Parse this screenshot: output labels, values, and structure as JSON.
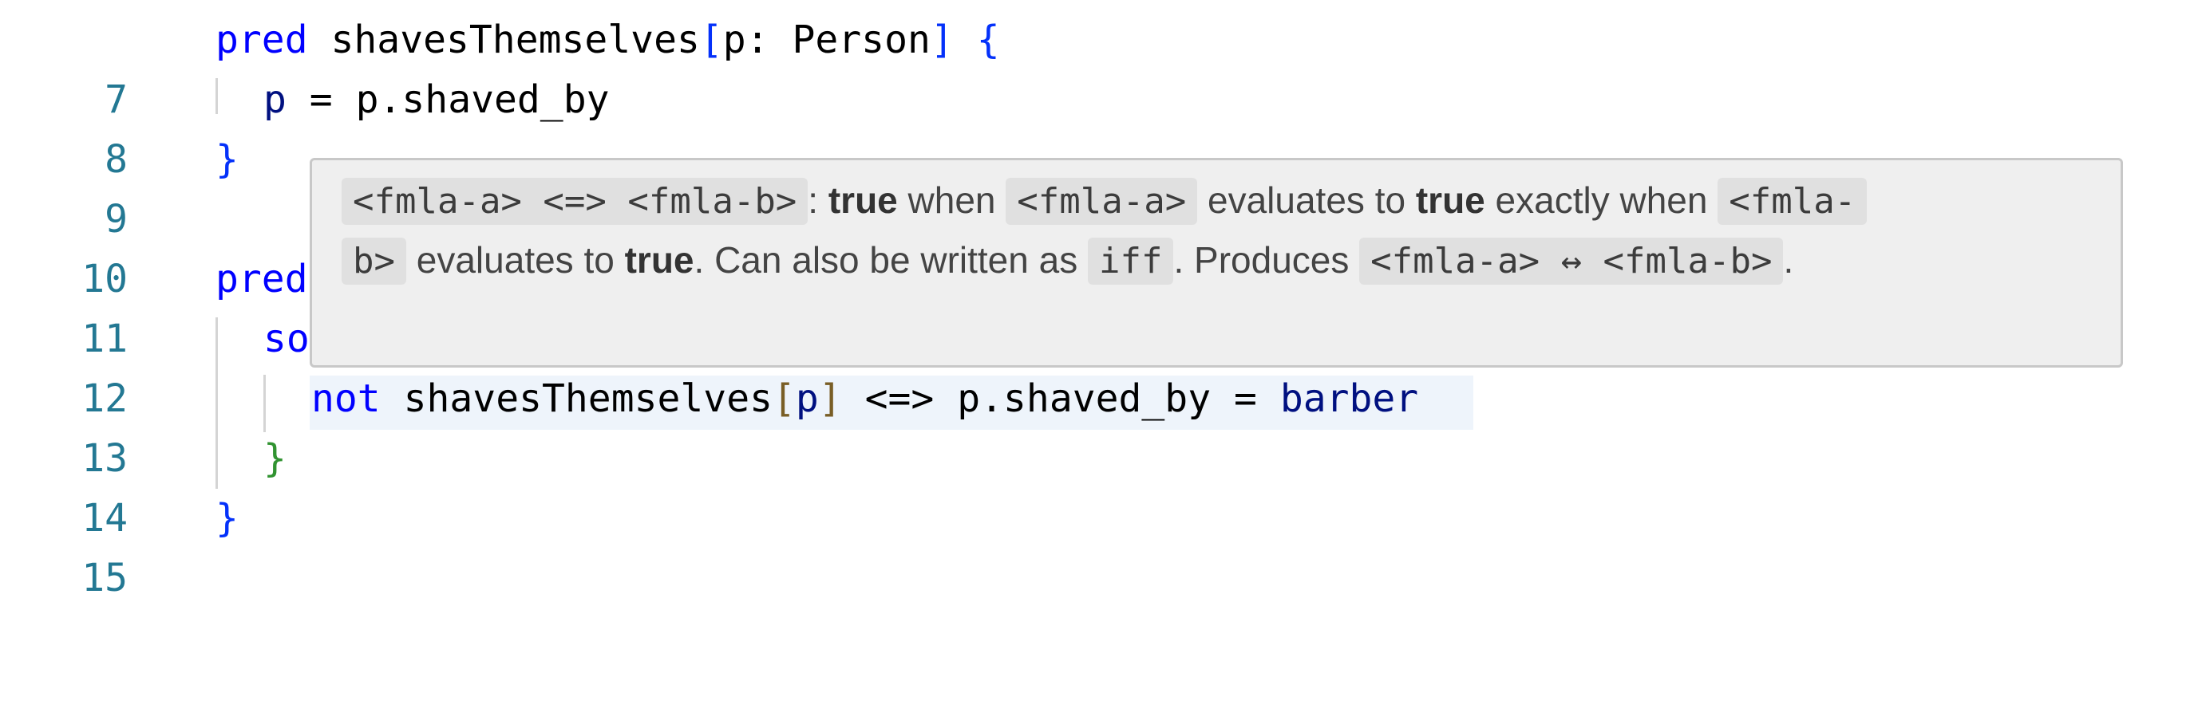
{
  "editor": {
    "lines": [
      {
        "num": "7",
        "kw": "pred",
        "rest": "shavesThemselves",
        "br_open": "[",
        "param": "p: Person",
        "br_close": "]",
        "brace": "{"
      },
      {
        "num": "8",
        "ident": "p",
        "rest": " = p.shaved_by"
      },
      {
        "num": "9",
        "brace": "}"
      },
      {
        "num": "10"
      },
      {
        "num": "11",
        "kw": "pred"
      },
      {
        "num": "12",
        "kw": "so"
      },
      {
        "num": "13",
        "kw": "not",
        "rest": "shavesThemselves",
        "br_open": "[",
        "param": "p",
        "br_close": "]",
        "op": "<=>",
        "rest2": "p.shaved_by =",
        "ident": "barber"
      },
      {
        "num": "14",
        "brace": "}"
      },
      {
        "num": "15",
        "brace": "}"
      }
    ]
  },
  "hover": {
    "chip_op": "<fmla-a> <=> <fmla-b>",
    "t1": ":",
    "true_word": "true",
    "t2": "when",
    "chip_a": "<fmla-a>",
    "t3": "evaluates to",
    "t4": "exactly when",
    "chip_b_part1": "<fmla-",
    "chip_b_part2": "b>",
    "t5": "evaluates to",
    "t6": ". Can also be written as",
    "chip_iff": "iff",
    "t7": ". Produces",
    "chip_produces": "<fmla-a> ↔ <fmla-b>",
    "t8": "."
  }
}
